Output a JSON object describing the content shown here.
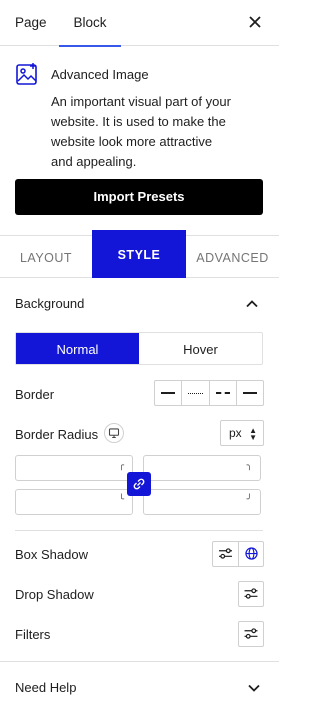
{
  "inspector": {
    "tabs": [
      {
        "label": "Page"
      },
      {
        "label": "Block"
      }
    ],
    "active_tab": "Block"
  },
  "block": {
    "icon": "image-icon",
    "title": "Advanced Image",
    "description": "An important visual part of your website. It is used to make the website look more attractive and appealing."
  },
  "import_presets_label": "Import Presets",
  "style_tabs": [
    {
      "label": "LAYOUT"
    },
    {
      "label": "STYLE"
    },
    {
      "label": "ADVANCED"
    }
  ],
  "active_style_tab": "STYLE",
  "background": {
    "label": "Background",
    "states": [
      {
        "label": "Normal"
      },
      {
        "label": "Hover"
      }
    ],
    "active_state": "Normal"
  },
  "border": {
    "label": "Border"
  },
  "border_radius": {
    "label": "Border Radius",
    "unit": "px"
  },
  "box_shadow": {
    "label": "Box Shadow"
  },
  "drop_shadow": {
    "label": "Drop Shadow"
  },
  "filters": {
    "label": "Filters"
  },
  "need_help": {
    "label": "Need Help"
  },
  "colors": {
    "accent": "#1316d6",
    "primary_button": "#000000",
    "tab_underline": "#3858e9"
  }
}
